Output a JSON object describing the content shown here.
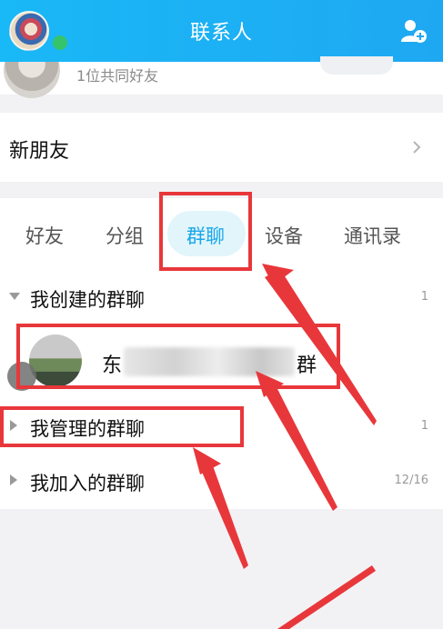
{
  "header": {
    "title": "联系人"
  },
  "recommend_peek": {
    "text": "1位共同好友"
  },
  "new_friends": {
    "label": "新朋友"
  },
  "tabs": [
    {
      "label": "好友"
    },
    {
      "label": "分组"
    },
    {
      "label": "群聊"
    },
    {
      "label": "设备"
    },
    {
      "label": "通讯录"
    }
  ],
  "active_tab": "群聊",
  "groups": [
    {
      "label": "我创建的群聊",
      "count": "1",
      "expanded": true
    },
    {
      "label": "我管理的群聊",
      "count": "1",
      "expanded": false
    },
    {
      "label": "我加入的群聊",
      "count": "12/16",
      "expanded": false
    }
  ],
  "chat": {
    "name_start": "东",
    "name_end": "群"
  },
  "colors": {
    "header": "#19b8f6",
    "accent": "#1aa7e8",
    "annotation": "#e8373b"
  },
  "icons": {
    "add_contact": "add-contact-icon",
    "chevron": "chevron-right-icon"
  }
}
